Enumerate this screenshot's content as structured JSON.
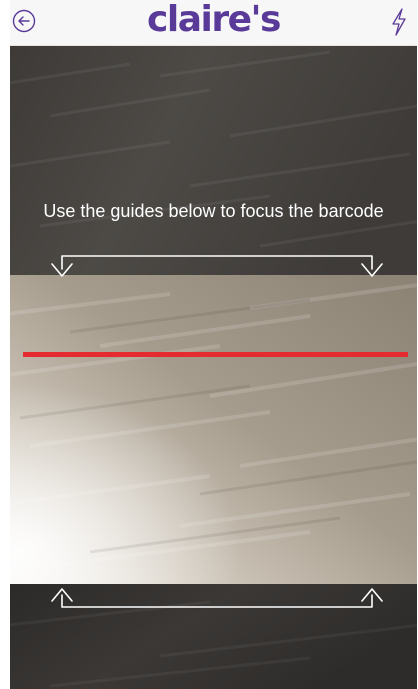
{
  "header": {
    "logo_text": "claire's",
    "back_icon": "back-arrow-circle-icon",
    "flash_icon": "lightning-bolt-icon",
    "logo_color": "#5a3a98",
    "icon_color": "#5a3a98",
    "background": "#f7f7f7"
  },
  "scanner": {
    "instruction": "Use the guides below to focus the barcode",
    "scan_line_color": "#e52a30",
    "guide_color": "#ffffff"
  }
}
